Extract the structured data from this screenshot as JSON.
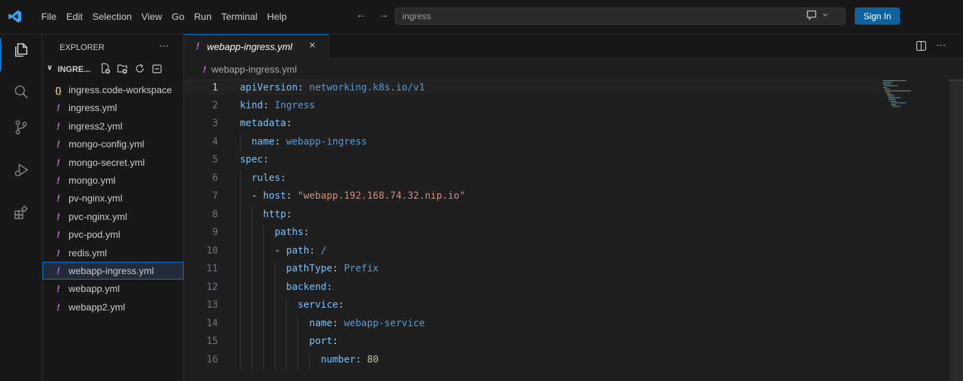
{
  "titlebar": {
    "menu": [
      "File",
      "Edit",
      "Selection",
      "View",
      "Go",
      "Run",
      "Terminal",
      "Help"
    ],
    "nav_arrows": "← →",
    "search_text": "ingress",
    "signin_label": "Sign In"
  },
  "activitybar": {
    "items": [
      "explorer-icon",
      "search-icon",
      "source-control-icon",
      "run-debug-icon",
      "extensions-icon"
    ]
  },
  "sidebar": {
    "header": "EXPLORER",
    "more": "···",
    "folder_name": "INGRE...",
    "files": [
      {
        "name": "ingress.code-workspace",
        "icon": "{}"
      },
      {
        "name": "ingress.yml",
        "icon": "!"
      },
      {
        "name": "ingress2.yml",
        "icon": "!"
      },
      {
        "name": "mongo-config.yml",
        "icon": "!"
      },
      {
        "name": "mongo-secret.yml",
        "icon": "!"
      },
      {
        "name": "mongo.yml",
        "icon": "!"
      },
      {
        "name": "pv-nginx.yml",
        "icon": "!"
      },
      {
        "name": "pvc-nginx.yml",
        "icon": "!"
      },
      {
        "name": "pvc-pod.yml",
        "icon": "!"
      },
      {
        "name": "redis.yml",
        "icon": "!"
      },
      {
        "name": "webapp-ingress.yml",
        "icon": "!",
        "selected": true
      },
      {
        "name": "webapp.yml",
        "icon": "!"
      },
      {
        "name": "webapp2.yml",
        "icon": "!"
      }
    ]
  },
  "editor": {
    "tab": {
      "icon": "!",
      "label": "webapp-ingress.yml",
      "close": "×"
    },
    "more": "···",
    "breadcrumb": {
      "icon": "!",
      "label": "webapp-ingress.yml"
    },
    "lines": [
      {
        "n": "1",
        "indent": 0,
        "key": "apiVersion",
        "val": "networking.k8s.io/v1",
        "type": "v"
      },
      {
        "n": "2",
        "indent": 0,
        "key": "kind",
        "val": "Ingress",
        "type": "v"
      },
      {
        "n": "3",
        "indent": 0,
        "key": "metadata",
        "val": "",
        "type": "v"
      },
      {
        "n": "4",
        "indent": 1,
        "key": "name",
        "val": "webapp-ingress",
        "type": "v"
      },
      {
        "n": "5",
        "indent": 0,
        "key": "spec",
        "val": "",
        "type": "v"
      },
      {
        "n": "6",
        "indent": 1,
        "key": "rules",
        "val": "",
        "type": "v"
      },
      {
        "n": "7",
        "indent": 1,
        "dash": true,
        "key": "host",
        "val": "\"webapp.192.168.74.32.nip.io\"",
        "type": "s"
      },
      {
        "n": "8",
        "indent": 2,
        "key": "http",
        "val": "",
        "type": "v"
      },
      {
        "n": "9",
        "indent": 3,
        "key": "paths",
        "val": "",
        "type": "v"
      },
      {
        "n": "10",
        "indent": 3,
        "dash": true,
        "key": "path",
        "val": "/",
        "type": "v"
      },
      {
        "n": "11",
        "indent": 4,
        "key": "pathType",
        "val": "Prefix",
        "type": "v"
      },
      {
        "n": "12",
        "indent": 4,
        "key": "backend",
        "val": "",
        "type": "v"
      },
      {
        "n": "13",
        "indent": 5,
        "key": "service",
        "val": "",
        "type": "v"
      },
      {
        "n": "14",
        "indent": 6,
        "key": "name",
        "val": "webapp-service",
        "type": "v"
      },
      {
        "n": "15",
        "indent": 6,
        "key": "port",
        "val": "",
        "type": "v"
      },
      {
        "n": "16",
        "indent": 7,
        "key": "number",
        "val": "80",
        "type": "n"
      }
    ]
  },
  "colors": {
    "accent": "#0078d4",
    "yaml_icon": "#cb69d6",
    "key": "#569cd6",
    "string": "#ce9178",
    "number": "#b5cea8",
    "signin_bg": "#0e639c"
  }
}
